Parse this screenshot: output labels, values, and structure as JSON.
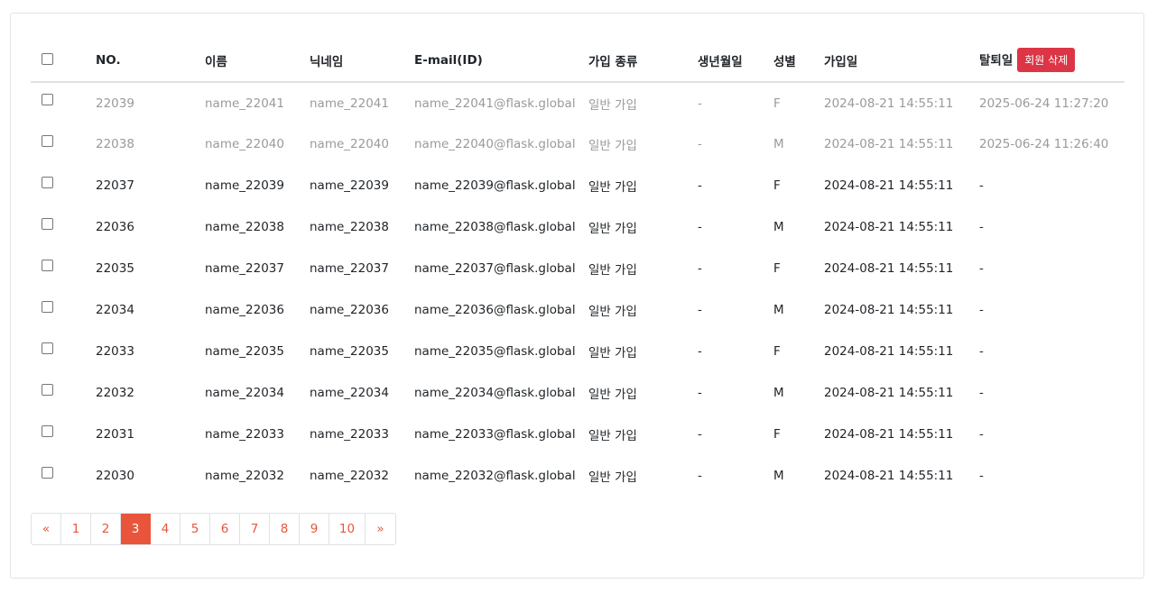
{
  "table": {
    "headers": [
      "NO.",
      "이름",
      "닉네임",
      "E-mail(ID)",
      "가입 종류",
      "생년월일",
      "성별",
      "가입일",
      "탈퇴일"
    ],
    "delete_button": "회원 삭제",
    "rows": [
      {
        "no": "22039",
        "name": "name_22041",
        "nick": "name_22041",
        "email": "name_22041@flask.global",
        "type": "일반 가입",
        "birth": "-",
        "gender": "F",
        "joined": "2024-08-21 14:55:11",
        "left": "2025-06-24 11:27:20",
        "withdrawn": true
      },
      {
        "no": "22038",
        "name": "name_22040",
        "nick": "name_22040",
        "email": "name_22040@flask.global",
        "type": "일반 가입",
        "birth": "-",
        "gender": "M",
        "joined": "2024-08-21 14:55:11",
        "left": "2025-06-24 11:26:40",
        "withdrawn": true
      },
      {
        "no": "22037",
        "name": "name_22039",
        "nick": "name_22039",
        "email": "name_22039@flask.global",
        "type": "일반 가입",
        "birth": "-",
        "gender": "F",
        "joined": "2024-08-21 14:55:11",
        "left": "-",
        "withdrawn": false
      },
      {
        "no": "22036",
        "name": "name_22038",
        "nick": "name_22038",
        "email": "name_22038@flask.global",
        "type": "일반 가입",
        "birth": "-",
        "gender": "M",
        "joined": "2024-08-21 14:55:11",
        "left": "-",
        "withdrawn": false
      },
      {
        "no": "22035",
        "name": "name_22037",
        "nick": "name_22037",
        "email": "name_22037@flask.global",
        "type": "일반 가입",
        "birth": "-",
        "gender": "F",
        "joined": "2024-08-21 14:55:11",
        "left": "-",
        "withdrawn": false
      },
      {
        "no": "22034",
        "name": "name_22036",
        "nick": "name_22036",
        "email": "name_22036@flask.global",
        "type": "일반 가입",
        "birth": "-",
        "gender": "M",
        "joined": "2024-08-21 14:55:11",
        "left": "-",
        "withdrawn": false
      },
      {
        "no": "22033",
        "name": "name_22035",
        "nick": "name_22035",
        "email": "name_22035@flask.global",
        "type": "일반 가입",
        "birth": "-",
        "gender": "F",
        "joined": "2024-08-21 14:55:11",
        "left": "-",
        "withdrawn": false
      },
      {
        "no": "22032",
        "name": "name_22034",
        "nick": "name_22034",
        "email": "name_22034@flask.global",
        "type": "일반 가입",
        "birth": "-",
        "gender": "M",
        "joined": "2024-08-21 14:55:11",
        "left": "-",
        "withdrawn": false
      },
      {
        "no": "22031",
        "name": "name_22033",
        "nick": "name_22033",
        "email": "name_22033@flask.global",
        "type": "일반 가입",
        "birth": "-",
        "gender": "F",
        "joined": "2024-08-21 14:55:11",
        "left": "-",
        "withdrawn": false
      },
      {
        "no": "22030",
        "name": "name_22032",
        "nick": "name_22032",
        "email": "name_22032@flask.global",
        "type": "일반 가입",
        "birth": "-",
        "gender": "M",
        "joined": "2024-08-21 14:55:11",
        "left": "-",
        "withdrawn": false
      }
    ]
  },
  "pagination": {
    "prev": "«",
    "next": "»",
    "pages": [
      "1",
      "2",
      "3",
      "4",
      "5",
      "6",
      "7",
      "8",
      "9",
      "10"
    ],
    "current": "3"
  },
  "colors": {
    "accent": "#e8553b",
    "danger": "#dc3545",
    "muted_text": "#9a9a9a"
  }
}
